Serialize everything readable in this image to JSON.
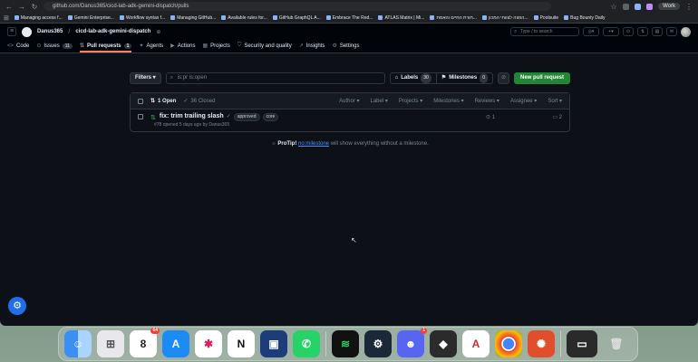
{
  "browser": {
    "url": "github.com/Danus365/cicd-lab-adk-gemini-dispatch/pulls",
    "profile_label": "Work",
    "bookmarks": [
      "Managing access f...",
      "Gemini Enterprise...",
      "Workflow syntax f...",
      "Managing GitHub...",
      "Available rules for...",
      "GitHub GraphQL A...",
      "Embrace The Red...",
      "ATLAS Matrix | Mi...",
      "תורת החיים והאמת...",
      "הפצה לצוותי המכון...",
      "Poolsuite",
      "Bug Bounty Daily"
    ]
  },
  "header": {
    "owner": "Danus365",
    "separator": "/",
    "repo": "cicd-lab-adk-gemini-dispatch",
    "search_placeholder": "Type / to search"
  },
  "repo_nav": {
    "tabs": [
      {
        "icon": "<>",
        "label": "Code",
        "count": ""
      },
      {
        "icon": "⊙",
        "label": "Issues",
        "count": "11"
      },
      {
        "icon": "⇅",
        "label": "Pull requests",
        "count": "1"
      },
      {
        "icon": "✦",
        "label": "Agents",
        "count": ""
      },
      {
        "icon": "▶",
        "label": "Actions",
        "count": ""
      },
      {
        "icon": "▦",
        "label": "Projects",
        "count": ""
      },
      {
        "icon": "⛉",
        "label": "Security and quality",
        "count": ""
      },
      {
        "icon": "↗",
        "label": "Insights",
        "count": ""
      },
      {
        "icon": "⚙",
        "label": "Settings",
        "count": ""
      }
    ]
  },
  "toolbar": {
    "filters_label": "Filters ▾",
    "filter_value": "is:pr is:open",
    "labels_label": "Labels",
    "labels_count": "30",
    "milestones_label": "Milestones",
    "milestones_count": "0",
    "new_pr_label": "New pull request"
  },
  "list": {
    "open_label": "1 Open",
    "closed_label": "36 Closed",
    "sort_columns": [
      "Author ▾",
      "Label ▾",
      "Projects ▾",
      "Milestones ▾",
      "Reviews ▾",
      "Assignee ▾",
      "Sort ▾"
    ],
    "rows": [
      {
        "title": "fix: trim trailing slash",
        "labels": [
          "approved",
          "core"
        ],
        "meta": "#78 opened 5 days ago by Danus365",
        "reviews": "1",
        "comments": "2"
      }
    ]
  },
  "protip": {
    "lead": "ProTip!",
    "link": "no:milestone",
    "rest": "will show everything without a milestone."
  },
  "dock": {
    "calendar_day": "8",
    "calendar_badge": "64",
    "discord_badge": "1"
  }
}
